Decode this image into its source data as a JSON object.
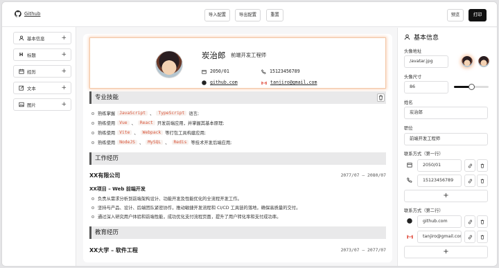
{
  "header": {
    "github_label": "Github",
    "import_label": "导入配置",
    "export_label": "导出配置",
    "reset_label": "重置",
    "preview_label": "预览",
    "print_label": "打印"
  },
  "sidebar": {
    "items": [
      {
        "label": "基本信息",
        "icon": "user-icon"
      },
      {
        "label": "标题",
        "icon": "heading-icon"
      },
      {
        "label": "经历",
        "icon": "calendar-icon"
      },
      {
        "label": "文本",
        "icon": "edit-icon"
      },
      {
        "label": "图片",
        "icon": "image-icon"
      }
    ]
  },
  "resume": {
    "name": "炭治郎",
    "role": "前端开发工程师",
    "birth": "2050/01",
    "phone": "15123456789",
    "github": "github.com",
    "email": "tanjiro@gmail.com",
    "skills_title": "专业技能",
    "skills": {
      "s1_pre": "熟练掌握",
      "s1_c1": "JavaScript",
      "s1_sep": "、",
      "s1_c2": "TypeScript",
      "s1_post": "语言;",
      "s2_pre": "熟练使用",
      "s2_c1": "Vue",
      "s2_sep": "、",
      "s2_c2": "React",
      "s2_post": "开发前端应用，并掌握其基本原理;",
      "s3_pre": "熟练使用",
      "s3_c1": "Vite",
      "s3_sep": "、",
      "s3_c2": "Webpack",
      "s3_post": "等打包工具构建应用;",
      "s4_pre": "熟练使用",
      "s4_c1": "NodeJS",
      "s4_sep1": "、",
      "s4_c2": "MySQL",
      "s4_sep2": "、",
      "s4_c3": "Redis",
      "s4_post": "等技术开发后端应用;"
    },
    "work_title": "工作经历",
    "work_org": "XX有限公司",
    "work_date": "2077/07 – 2080/07",
    "work_project": "XX项目 – Web 前端开发",
    "work_points": [
      "负责从需求分析到前端架构设计、功能开发及性能优化的全流程开发工作。",
      "坚持与产品、设计、后端团队紧密协作，推动敏捷开发流程和 CI/CD 工具链的落地，确保高质量的交付。",
      "通过深入研究用户体验和前端性能，成功优化支付流程页面，提升了用户转化率和支付成功率。"
    ],
    "edu_title": "教育经历",
    "edu_org": "XX大学 – 软件工程",
    "edu_date": "2073/07 – 2077/07"
  },
  "panel": {
    "title": "基本信息",
    "avatar_label": "头像地址",
    "avatar_value": "/avatar.jpg",
    "size_label": "头像尺寸",
    "size_value": "86",
    "size_slider_fraction": 0.5,
    "name_label": "姓名",
    "name_value": "炭治郎",
    "role_label": "职位",
    "role_value": "前端开发工程师",
    "contact1_label": "联系方式（第一行）",
    "contact1": [
      "2050/01",
      "15123456789"
    ],
    "contact2_label": "联系方式（第二行）",
    "contact2": [
      "github.com",
      "tanjiro@gmail.com"
    ],
    "add_label": "+"
  }
}
